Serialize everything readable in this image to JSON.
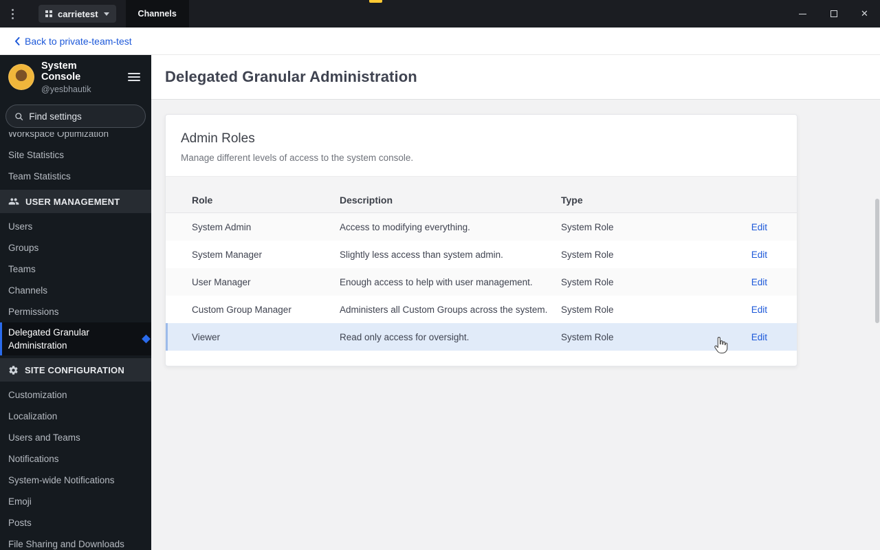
{
  "window": {
    "server_name": "carrietest",
    "active_tab": "Channels"
  },
  "back_bar": {
    "label": "Back to private-team-test"
  },
  "sidebar": {
    "header": {
      "title": "System Console",
      "username": "@yesbhautik"
    },
    "search": {
      "placeholder": "Find settings"
    },
    "top_items": [
      {
        "label": "Workspace Optimization",
        "clipped": true
      },
      {
        "label": "Site Statistics"
      },
      {
        "label": "Team Statistics"
      }
    ],
    "sections": [
      {
        "label": "USER MANAGEMENT",
        "icon": "people-icon",
        "items": [
          {
            "label": "Users"
          },
          {
            "label": "Groups"
          },
          {
            "label": "Teams"
          },
          {
            "label": "Channels"
          },
          {
            "label": "Permissions"
          },
          {
            "label": "Delegated Granular Administration",
            "active": true
          }
        ]
      },
      {
        "label": "SITE CONFIGURATION",
        "icon": "gear-icon",
        "items": [
          {
            "label": "Customization"
          },
          {
            "label": "Localization"
          },
          {
            "label": "Users and Teams"
          },
          {
            "label": "Notifications"
          },
          {
            "label": "System-wide Notifications"
          },
          {
            "label": "Emoji"
          },
          {
            "label": "Posts"
          },
          {
            "label": "File Sharing and Downloads"
          }
        ]
      }
    ]
  },
  "main": {
    "page_title": "Delegated Granular Administration",
    "card": {
      "heading": "Admin Roles",
      "description": "Manage different levels of access to the system console.",
      "table": {
        "columns": [
          "Role",
          "Description",
          "Type"
        ],
        "action_label": "Edit",
        "rows": [
          {
            "role": "System Admin",
            "description": "Access to modifying everything.",
            "type": "System Role"
          },
          {
            "role": "System Manager",
            "description": "Slightly less access than system admin.",
            "type": "System Role"
          },
          {
            "role": "User Manager",
            "description": "Enough access to help with user management.",
            "type": "System Role"
          },
          {
            "role": "Custom Group Manager",
            "description": "Administers all Custom Groups across the system.",
            "type": "System Role"
          },
          {
            "role": "Viewer",
            "description": "Read only access for oversight.",
            "type": "System Role",
            "highlighted": true
          }
        ]
      }
    }
  },
  "icons": {
    "kebab_menu": "kebab-menu-icon",
    "server_grid": "grid-icon",
    "server_chevron": "chevron-down-icon",
    "minimize": "minimize-icon",
    "maximize": "maximize-icon",
    "close_glyph": "✕",
    "back_chevron": "chevron-left-icon",
    "sidebar_menu": "hamburger-icon",
    "search": "search-icon",
    "user_management_section": "people-icon",
    "site_configuration_section": "gear-icon",
    "active_pointer": "diamond-pointer-icon",
    "cursor": "hand-cursor"
  },
  "colors": {
    "accent": "#1c58d9",
    "link": "#1c58d9",
    "row_highlight": "#e1ebf9",
    "sidebar_bg": "#151a1f",
    "titlebar_bg": "#1b1d22",
    "notch": "#ffc933"
  }
}
